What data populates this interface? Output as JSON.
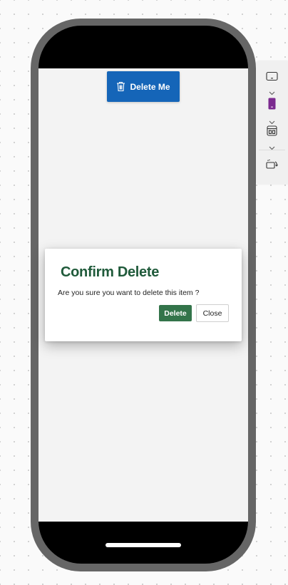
{
  "app_bar": {
    "delete_me_label": "Delete Me",
    "delete_me_icon": "trash-icon",
    "button_color": "#1565b8"
  },
  "dialog": {
    "title": "Confirm Delete",
    "message": "Are you sure you want to delete this item ?",
    "delete_label": "Delete",
    "close_label": "Close",
    "title_color": "#1f5a3a",
    "delete_color": "#33744a"
  },
  "toolbar": {
    "items": [
      {
        "icon": "tablet-landscape-icon",
        "has_dropdown": true
      },
      {
        "icon": "phone-device-icon",
        "has_dropdown": true,
        "accent": "#7b2a8f"
      },
      {
        "icon": "browser-window-icon",
        "has_dropdown": true
      },
      {
        "icon": "rotate-device-icon",
        "has_dropdown": false
      }
    ]
  },
  "colors": {
    "phone_frame": "#666666",
    "screen_bg": "#f3f3f3"
  }
}
